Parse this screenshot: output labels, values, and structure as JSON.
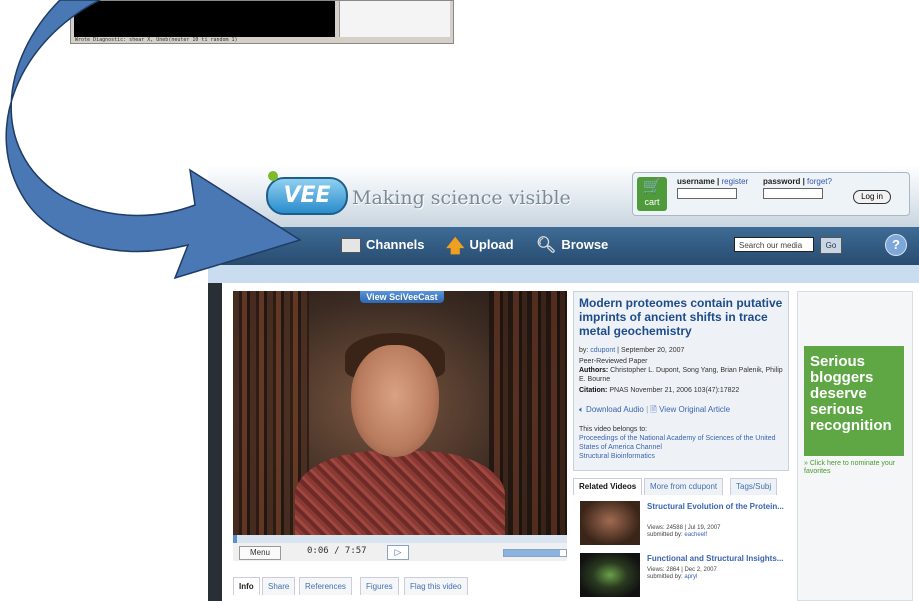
{
  "terminal": {
    "status_text": "Wrote Diagnostic: shear X, Uneb(neuter 10 ti random 1)"
  },
  "site": {
    "logo": "VEE",
    "tagline": "Making science visible",
    "login": {
      "cart_label": "cart",
      "username_label": "username",
      "register_link": "register",
      "password_label": "password",
      "forget_link": "forget?",
      "login_button": "Log in"
    },
    "nav": {
      "items": [
        "Channels",
        "Upload",
        "Browse"
      ],
      "search_placeholder": "Search our media",
      "go_button": "Go",
      "help": "?"
    },
    "video": {
      "badge": "View SciVeeCast",
      "menu_button": "Menu",
      "timecode": "0:06 / 7:57",
      "progress": 0.013,
      "volume": 0.9
    },
    "tabs": [
      "Info",
      "Share",
      "References",
      "Figures",
      "Flag this video"
    ],
    "paper": {
      "title": "Modern proteomes contain putative imprints of ancient shifts in trace metal geochemistry",
      "by_label": "by:",
      "author_link": "cdupont",
      "separator": "|",
      "date": "September 20, 2007",
      "type": "Peer-Reviewed Paper",
      "authors_label": "Authors:",
      "authors": "Christopher L. Dupont, Song Yang, Brian Palenik, Philip E. Bourne",
      "citation_label": "Citation:",
      "citation": "PNAS November 21, 2006 103(47):17822",
      "download_audio": "Download Audio",
      "view_original": "View Original Article",
      "belongs_label": "This video belongs to:",
      "channel_link": "Proceedings of the National Academy of Sciences of the United States of America Channel",
      "channel_sub": "Structural Bioinformatics"
    },
    "related_tabs": [
      "Related Videos",
      "More from cdupont",
      "Tags/Subj"
    ],
    "related": [
      {
        "title": "Structural Evolution of the Protein...",
        "meta": "Views: 24588 | Jul 19, 2007",
        "submitted_label": "submitted by:",
        "submitter": "eacheelf"
      },
      {
        "title": "Functional and Structural Insights...",
        "meta": "Views: 2864 | Dec 2, 2007",
        "submitted_label": "submitted by:",
        "submitter": "apryl"
      }
    ],
    "ad": {
      "headline": "Serious bloggers deserve serious recognition",
      "link": "» Click here to nominate your favorites"
    }
  },
  "colors": {
    "arrow_fill": "#4a78b4",
    "nav_bar": "#355d86",
    "ad_green": "#5fa745",
    "link_blue": "#3a64b0"
  }
}
